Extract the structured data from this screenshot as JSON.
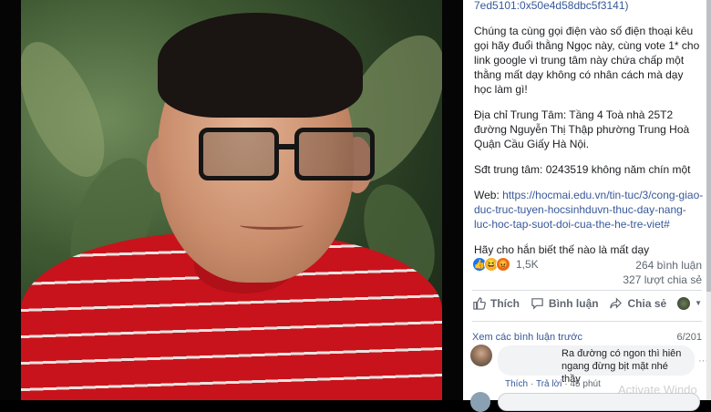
{
  "post": {
    "hash_line": "7ed5101:0x50e4d58dbc5f3141)",
    "para1": "Chúng ta cùng gọi điện vào số điện thoại kêu gọi hãy đuổi thằng Ngọc này, cùng vote 1* cho link google vì trung tâm này chứa chấp một thằng mất dạy không có nhân cách mà dạy học làm gì!",
    "para2": "Địa chỉ Trung Tâm: Tầng 4 Toà nhà 25T2 đường Nguyễn Thị Thập phường Trung Hoà Quận Cầu Giấy Hà Nội.",
    "para3": "Sđt trung tâm: 0243519 không năm chín một",
    "web_label": "Web: ",
    "web_link": "https://hocmai.edu.vn/tin-tuc/3/cong-giao-duc-truc-tuyen-hocsinhduvn-thuc-day-nang-luc-hoc-tap-suot-doi-cua-the-he-tre-viet#",
    "para5": "Hãy cho hắn biết thế nào là mất dạy"
  },
  "stats": {
    "reactions": "1,5K",
    "comments": "264 bình luận",
    "shares": "327 lượt chia sẻ"
  },
  "actions": {
    "like": "Thích",
    "comment": "Bình luận",
    "share": "Chia sẻ"
  },
  "comments": {
    "view_previous": "Xem các bình luận trước",
    "page_count": "6/201",
    "first_text": "Ra đường có ngon thì hiên ngang đừng bịt mặt nhé thầy",
    "like": "Thích",
    "reply": "Trả lời",
    "time": "45 phút",
    "edit": "···"
  },
  "watermark": "Activate Windo",
  "colors": {
    "link": "#385898",
    "like": "#1877f2",
    "shirt": "#c8131c"
  }
}
